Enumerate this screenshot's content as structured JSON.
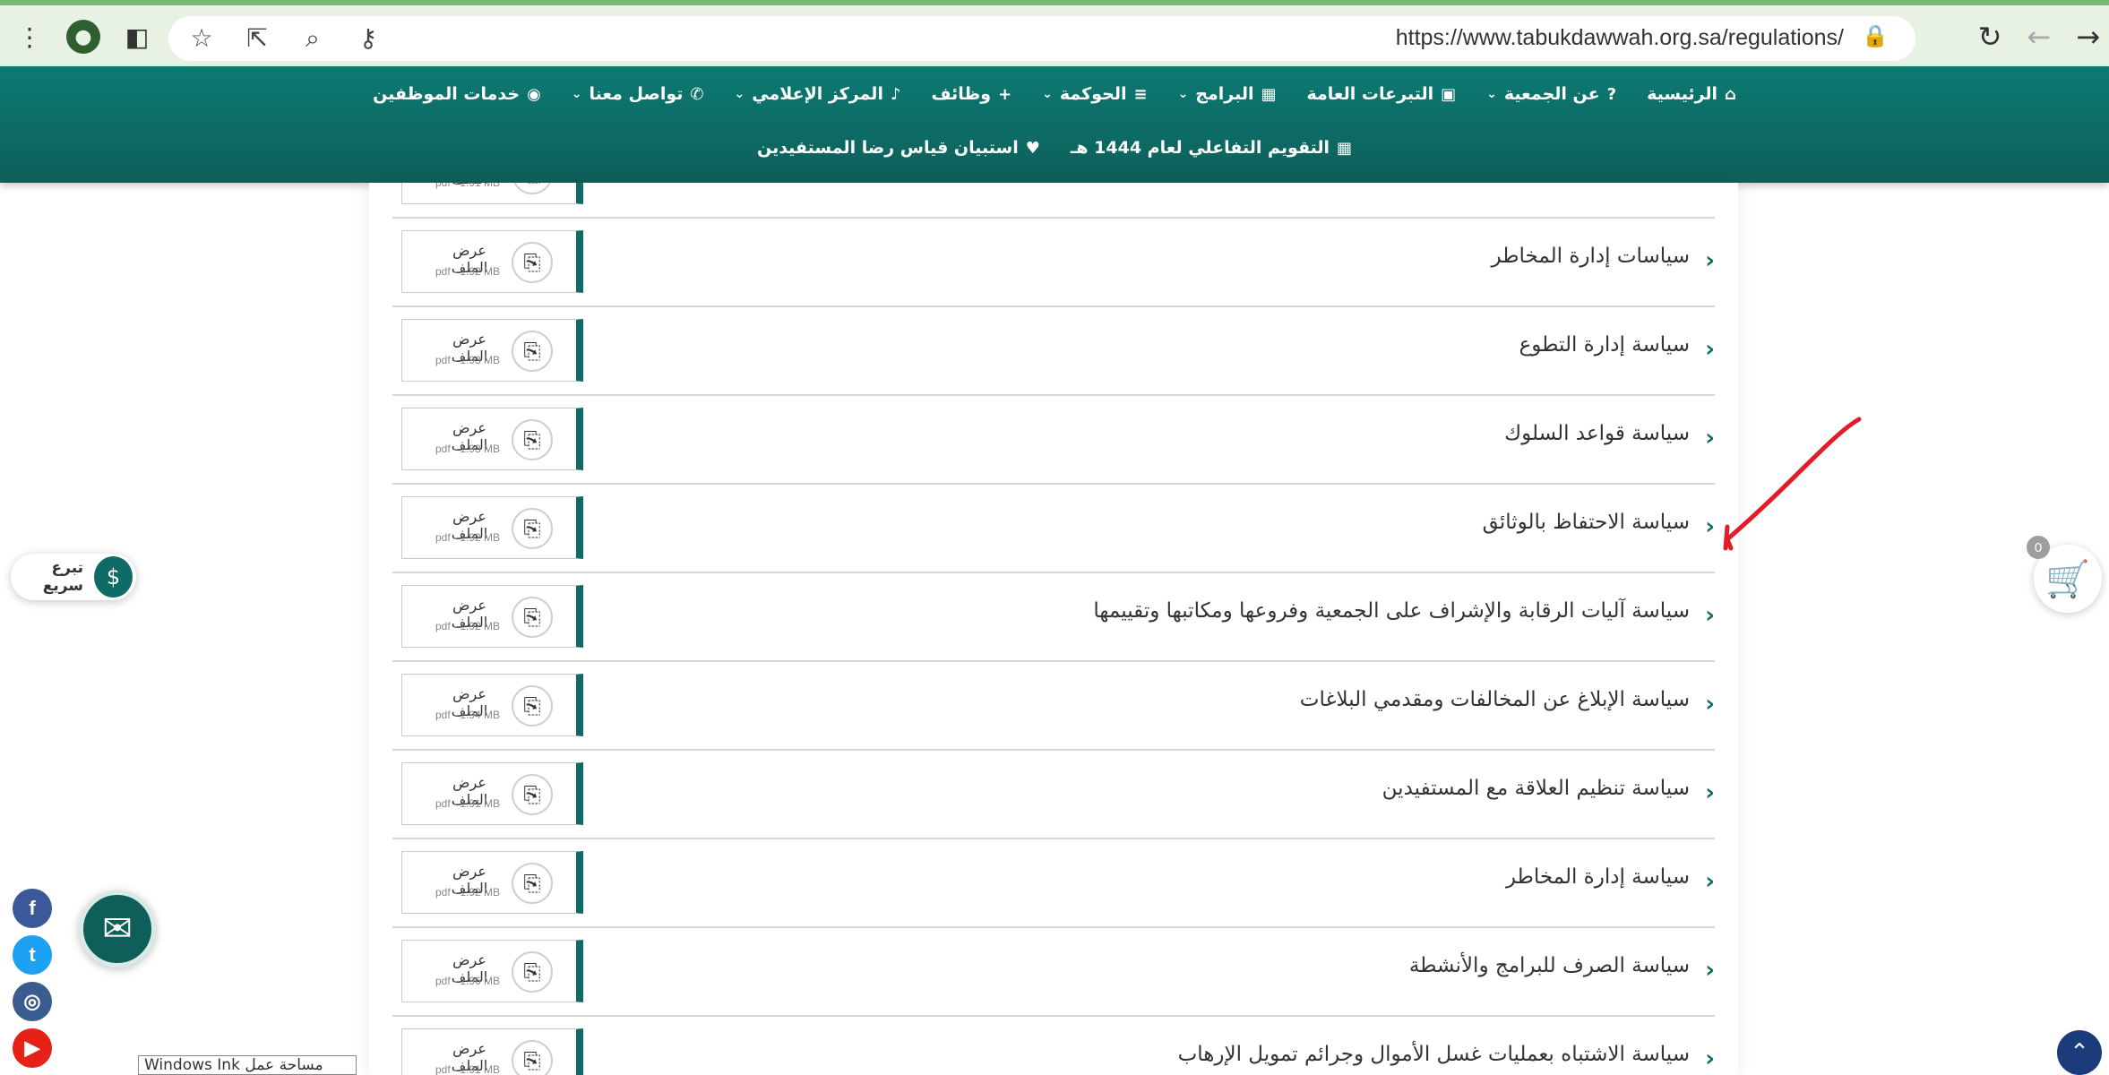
{
  "browser": {
    "url": "https://www.tabukdawwah.org.sa/regulations/",
    "icons": [
      "more-vert-icon",
      "profile-avatar-icon",
      "sidebar-toggle-icon",
      "bookmark-star-icon",
      "share-icon",
      "zoom-icon",
      "password-key-icon",
      "lock-icon",
      "reload-icon",
      "back-icon",
      "forward-icon"
    ]
  },
  "nav": {
    "row1": [
      {
        "label": "الرئيسية",
        "icon": "⌂"
      },
      {
        "label": "عن الجمعية",
        "icon": "?",
        "dropdown": true
      },
      {
        "label": "التبرعات العامة",
        "icon": "▣"
      },
      {
        "label": "البرامج",
        "icon": "▦",
        "dropdown": true
      },
      {
        "label": "الحوكمة",
        "icon": "≡",
        "dropdown": true
      },
      {
        "label": "وظائف",
        "icon": "+"
      },
      {
        "label": "المركز الإعلامي",
        "icon": "♪",
        "dropdown": true
      },
      {
        "label": "تواصل معنا",
        "icon": "✆",
        "dropdown": true
      },
      {
        "label": "خدمات الموظفين",
        "icon": "◉"
      }
    ],
    "row2": [
      {
        "label": "التقويم التفاعلي لعام 1444 هـ",
        "icon": "▦"
      },
      {
        "label": "استبيان قياس رضا المستفيدين",
        "icon": "♥"
      }
    ]
  },
  "regulations": {
    "view_label": "عرض الملف",
    "items": [
      {
        "title": "",
        "size": "pdf - 1.91 MB"
      },
      {
        "title": "سياسات إدارة المخاطر",
        "size": "pdf - 1.92 MB"
      },
      {
        "title": "سياسة إدارة التطوع",
        "size": "pdf - 1.93 MB"
      },
      {
        "title": "سياسة قواعد السلوك",
        "size": "pdf - 1.93 MB"
      },
      {
        "title": "سياسة الاحتفاظ بالوثائق",
        "size": "pdf - 1.92 MB"
      },
      {
        "title": "سياسة آليات الرقابة والإشراف على الجمعية وفروعها ومكاتبها وتقييمها",
        "size": "pdf - 1.92 MB"
      },
      {
        "title": "سياسة الإبلاغ عن المخالفات ومقدمي البلاغات",
        "size": "pdf - 1.94 MB"
      },
      {
        "title": "سياسة تنظيم العلاقة مع المستفيدين",
        "size": "pdf - 1.91 MB"
      },
      {
        "title": "سياسة إدارة المخاطر",
        "size": "pdf - 1.92 MB"
      },
      {
        "title": "سياسة الصرف للبرامج والأنشطة",
        "size": "pdf - 1.96 MB"
      },
      {
        "title": "سياسة الاشتباه بعمليات غسل الأموال وجرائم تمويل الإرهاب",
        "size": "pdf - 1.91 MB"
      }
    ]
  },
  "floating": {
    "quick_donate": "تبرع سريع",
    "cart_count": "0",
    "watermark": "Windows Ink مساحة عمل"
  },
  "colors": {
    "brand": "#0e6b66",
    "nav_top": "#0c7a72",
    "annotation": "#e11d2a"
  }
}
